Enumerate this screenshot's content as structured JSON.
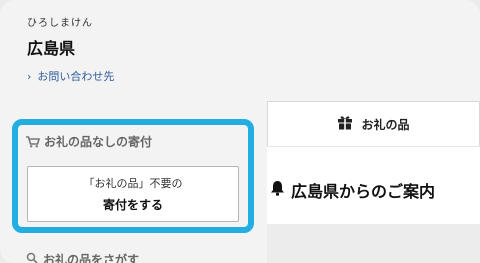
{
  "prefecture": {
    "kana": "ひろしまけん",
    "name": "広島県"
  },
  "contact": {
    "link_label": "お問い合わせ先"
  },
  "no_gift": {
    "title": "お礼の品なしの寄付",
    "button_sub": "「お礼の品」不要の",
    "button_main": "寄付をする"
  },
  "search": {
    "title": "お礼の品をさがす"
  },
  "tabs": {
    "gift_label": "お礼の品"
  },
  "guide": {
    "heading": "広島県からのご案内"
  },
  "colors": {
    "highlight": "#23aee2",
    "link": "#2f5d9b"
  }
}
